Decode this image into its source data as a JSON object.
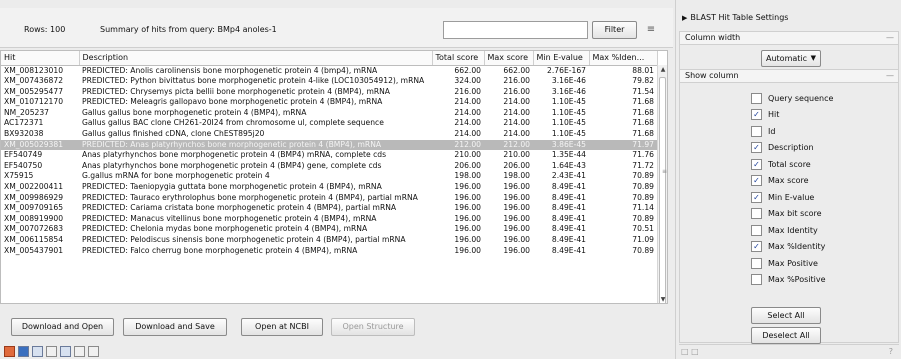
{
  "toolbar": {
    "rows_label": "Rows: 100",
    "summary": "Summary of hits from query: BMp4 anoles-1",
    "search_value": "",
    "filter_label": "Filter"
  },
  "table": {
    "columns": [
      "Hit",
      "Description",
      "Total score",
      "Max score",
      "Min E-value",
      "Max %Iden..."
    ],
    "rows": [
      [
        "XM_008123010",
        "PREDICTED: Anolis carolinensis bone morphogenetic protein 4 (bmp4), mRNA",
        "662.00",
        "662.00",
        "2.76E-167",
        "88.01"
      ],
      [
        "XM_007436872",
        "PREDICTED: Python bivittatus bone morphogenetic protein 4-like (LOC103054912), mRNA",
        "324.00",
        "216.00",
        "3.16E-46",
        "79.82"
      ],
      [
        "XM_005295477",
        "PREDICTED: Chrysemys picta bellii bone morphogenetic protein 4 (BMP4), mRNA",
        "216.00",
        "216.00",
        "3.16E-46",
        "71.54"
      ],
      [
        "XM_010712170",
        "PREDICTED: Meleagris gallopavo bone morphogenetic protein 4 (BMP4), mRNA",
        "214.00",
        "214.00",
        "1.10E-45",
        "71.68"
      ],
      [
        "NM_205237",
        "Gallus gallus bone morphogenetic protein 4 (BMP4), mRNA",
        "214.00",
        "214.00",
        "1.10E-45",
        "71.68"
      ],
      [
        "AC172371",
        "Gallus gallus BAC clone CH261-20I24 from chromosome ul, complete sequence",
        "214.00",
        "214.00",
        "1.10E-45",
        "71.68"
      ],
      [
        "BX932038",
        "Gallus gallus finished cDNA, clone ChEST895j20",
        "214.00",
        "214.00",
        "1.10E-45",
        "71.68"
      ],
      [
        "XM_005029381",
        "PREDICTED: Anas platyrhynchos bone morphogenetic protein 4 (BMP4), mRNA",
        "212.00",
        "212.00",
        "3.86E-45",
        "71.97"
      ],
      [
        "EF540749",
        "Anas platyrhynchos bone morphogenetic protein 4 (BMP4) mRNA, complete cds",
        "210.00",
        "210.00",
        "1.35E-44",
        "71.76"
      ],
      [
        "EF540750",
        "Anas platyrhynchos bone morphogenetic protein 4 (BMP4) gene, complete cds",
        "206.00",
        "206.00",
        "1.64E-43",
        "71.72"
      ],
      [
        "X75915",
        "G.gallus mRNA for bone morphogenetic protein 4",
        "198.00",
        "198.00",
        "2.43E-41",
        "70.89"
      ],
      [
        "XM_002200411",
        "PREDICTED: Taeniopygia guttata bone morphogenetic protein 4 (BMP4), mRNA",
        "196.00",
        "196.00",
        "8.49E-41",
        "70.89"
      ],
      [
        "XM_009986929",
        "PREDICTED: Tauraco erythrolophus bone morphogenetic protein 4 (BMP4), partial mRNA",
        "196.00",
        "196.00",
        "8.49E-41",
        "70.89"
      ],
      [
        "XM_009709165",
        "PREDICTED: Cariama cristata bone morphogenetic protein 4 (BMP4), partial mRNA",
        "196.00",
        "196.00",
        "8.49E-41",
        "71.14"
      ],
      [
        "XM_008919900",
        "PREDICTED: Manacus vitellinus bone morphogenetic protein 4 (BMP4), mRNA",
        "196.00",
        "196.00",
        "8.49E-41",
        "70.89"
      ],
      [
        "XM_007072683",
        "PREDICTED: Chelonia mydas bone morphogenetic protein 4 (BMP4), mRNA",
        "196.00",
        "196.00",
        "8.49E-41",
        "70.51"
      ],
      [
        "XM_006115854",
        "PREDICTED: Pelodiscus sinensis bone morphogenetic protein 4 (BMP4), partial mRNA",
        "196.00",
        "196.00",
        "8.49E-41",
        "71.09"
      ],
      [
        "XM_005437901",
        "PREDICTED: Falco cherrug bone morphogenetic protein 4 (BMP4), mRNA",
        "196.00",
        "196.00",
        "8.49E-41",
        "70.89"
      ]
    ],
    "selected_row_index": 7
  },
  "actions": {
    "download_open": "Download and Open",
    "download_save": "Download and Save",
    "open_ncbi": "Open at NCBI",
    "open_structure": "Open Structure"
  },
  "settings": {
    "title": "BLAST Hit Table Settings",
    "column_width_label": "Column width",
    "column_width_value": "Automatic",
    "show_column_label": "Show column",
    "columns": [
      {
        "label": "Query sequence",
        "checked": false
      },
      {
        "label": "Hit",
        "checked": true
      },
      {
        "label": "Id",
        "checked": false
      },
      {
        "label": "Description",
        "checked": true
      },
      {
        "label": "Total score",
        "checked": true
      },
      {
        "label": "Max score",
        "checked": true
      },
      {
        "label": "Min E-value",
        "checked": true
      },
      {
        "label": "Max bit score",
        "checked": false
      },
      {
        "label": "Max Identity",
        "checked": false
      },
      {
        "label": "Max %Identity",
        "checked": true
      },
      {
        "label": "Max Positive",
        "checked": false
      },
      {
        "label": "Max %Positive",
        "checked": false
      }
    ],
    "select_all": "Select All",
    "deselect_all": "Deselect All",
    "help_mark": "?"
  }
}
